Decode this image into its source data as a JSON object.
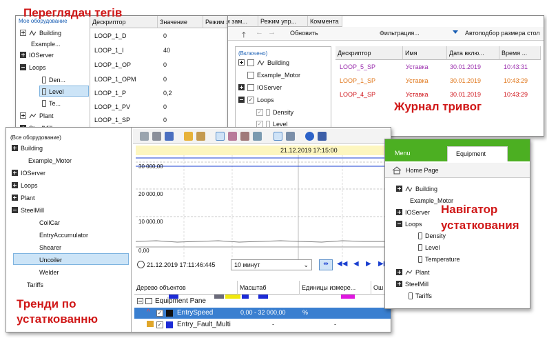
{
  "overlays": {
    "tag_viewer": "Переглядач тегів",
    "alarm_log": "Журнал тривог",
    "trends_line1": "Тренди по",
    "trends_line2": "устаткованню",
    "navigator_line1": "Навігатор",
    "navigator_line2": "устаткования"
  },
  "tag_window": {
    "root_label": "Мое оборудование",
    "tree": {
      "building": "Building",
      "example": "Example...",
      "ioserver": "IOServer",
      "loops": "Loops",
      "den": "Den...",
      "level": "Level",
      "te": "Te...",
      "plant": "Plant",
      "steelmill": "SteelMill"
    },
    "columns": [
      "Дескриптор",
      "Значение",
      "Режим зам...",
      "Режим упр...",
      "Коммента"
    ],
    "rows": [
      {
        "descriptor": "LOOP_1_D",
        "value": "0"
      },
      {
        "descriptor": "LOOP_1_I",
        "value": "40"
      },
      {
        "descriptor": "LOOP_1_OP",
        "value": "0"
      },
      {
        "descriptor": "LOOP_1_OPM",
        "value": "0"
      },
      {
        "descriptor": "LOOP_1_P",
        "value": "0,2"
      },
      {
        "descriptor": "LOOP_1_PV",
        "value": "0"
      },
      {
        "descriptor": "LOOP_1_SP",
        "value": "0"
      }
    ]
  },
  "alarm_window": {
    "toolbar": {
      "refresh": "Обновить",
      "filter": "Фильтрация...",
      "autofit": "Автоподбор размера стол"
    },
    "tree": {
      "root": "(Включено)",
      "building": "Building",
      "example": "Example_Motor",
      "ioserver": "IOServer",
      "loops": "Loops",
      "density": "Density",
      "level": "Level"
    },
    "columns": [
      "Дескриптор",
      "Имя",
      "Дата вклю...",
      "Время ..."
    ],
    "rows": [
      {
        "descriptor": "LOOP_5_SP",
        "name": "Уставка",
        "date": "30.01.2019",
        "time": "10:43:31",
        "color": "#9b2fae"
      },
      {
        "descriptor": "LOOP_1_SP",
        "name": "Уставка",
        "date": "30.01.2019",
        "time": "10:43:29",
        "color": "#e0761a"
      },
      {
        "descriptor": "LOOP_4_SP",
        "name": "Уставка",
        "date": "30.01.2019",
        "time": "10:43:29",
        "color": "#d0161c"
      }
    ]
  },
  "trend_window": {
    "tree": {
      "root": "(Все оборудование)",
      "building": "Building",
      "example": "Example_Motor",
      "ioserver": "IOServer",
      "loops": "Loops",
      "plant": "Plant",
      "steelmill": "SteelMill",
      "coilcar": "CoilCar",
      "entryacc": "EntryAccumulator",
      "shearer": "Shearer",
      "uncoiler": "Uncoiler",
      "welder": "Welder",
      "tariffs": "Tariffs"
    },
    "chart": {
      "timestamp": "21.12.2019 17:15:00",
      "y_labels": [
        "30 000,00",
        "20 000,00",
        "10 000,00",
        "0,00"
      ]
    },
    "time_value": "21.12.2019 17:11:46:445",
    "interval": "10 минут",
    "grid_headers": [
      "Дерево объектов",
      "Масштаб",
      "Единицы измере...",
      "Ош"
    ],
    "pane_label": "Equipment Pane",
    "rows": [
      {
        "name": "EntrySpeed",
        "scale": "0,00 - 32 000,00",
        "units": "%"
      },
      {
        "name": "Entry_Fault_Multi",
        "scale": "-",
        "units": "-"
      }
    ]
  },
  "nav_window": {
    "tabs": {
      "menu": "Menu",
      "equipment": "Equipment"
    },
    "home": "Home Page",
    "tree": {
      "building": "Building",
      "example": "Example_Motor",
      "ioserver": "IOServer",
      "loops": "Loops",
      "density": "Density",
      "level": "Level",
      "temperature": "Temperature",
      "plant": "Plant",
      "steelmill": "SteelMill",
      "tariffs": "Tariffs"
    }
  },
  "colors": {
    "accent": "#d01818",
    "selection": "#cce4f7",
    "nav_green": "#4caf22"
  }
}
